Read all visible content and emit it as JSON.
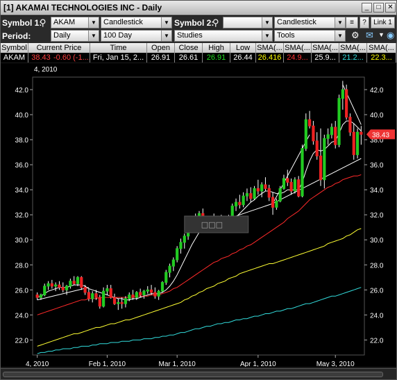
{
  "window": {
    "title": "[1] AKAMAI TECHNOLOGIES INC - Daily"
  },
  "toolbar": {
    "symbol1_label": "Symbol 1:",
    "symbol1_value": "AKAM",
    "chart_type_1": "Candlestick",
    "symbol2_label": "Symbol 2:",
    "symbol2_value": "",
    "chart_type_2": "Candlestick",
    "help_label": "?",
    "link_label": "Link 1",
    "period_label": "Period:",
    "period_value": "Daily",
    "range_value": "100 Day",
    "studies_value": "Studies",
    "tools_value": "Tools"
  },
  "quote": {
    "headers": [
      "Symbol",
      "Current Price",
      "Time",
      "Open",
      "Close",
      "High",
      "Low",
      "SMA(...",
      "SMA(...",
      "SMA(...",
      "SMA(...",
      "SMA(..."
    ],
    "row": [
      "AKAM",
      "38.43",
      "-0.60 (-1....",
      "Fri, Jan 15, 2...",
      "26.91",
      "26.61",
      "26.91",
      "26.44",
      "26.416",
      "24.9...",
      "25.9...",
      "21.2...",
      "22.3..."
    ],
    "colors": {
      "price": "#ff4040",
      "high": "#22dd22",
      "sma1": "#ffff00",
      "sma2": "#ff3030",
      "sma3": "#ffffff",
      "sma4": "#33dddd",
      "sma5": "#ffff00"
    }
  },
  "chart_data": {
    "type": "candlestick",
    "top_left_label": "4, 2010",
    "x_tick_labels": [
      "4, 2010",
      "Feb 1, 2010",
      "Mar 1, 2010",
      "Apr 1, 2010",
      "May 3, 2010"
    ],
    "x_tick_positions": [
      0,
      19,
      38,
      60,
      81
    ],
    "y_ticks": [
      "22.0",
      "24.0",
      "26.0",
      "28.0",
      "30.0",
      "32.0",
      "34.0",
      "36.0",
      "38.0",
      "40.0",
      "42.0"
    ],
    "ylim": [
      20.8,
      43.0
    ],
    "current_price_label": "38.43",
    "current_price": 38.43,
    "tooltip_text": "□□□",
    "colors": {
      "up": "#22cc22",
      "down": "#ee2222",
      "background": "#000000",
      "axis_text": "#ffffff",
      "price_box": "#ee3333"
    },
    "candles": [
      [
        25.6,
        25.8,
        25.2,
        25.4
      ],
      [
        25.4,
        25.7,
        25.2,
        25.6
      ],
      [
        25.6,
        26.5,
        25.5,
        26.3
      ],
      [
        26.3,
        26.7,
        26.0,
        26.5
      ],
      [
        26.5,
        26.8,
        26.1,
        26.3
      ],
      [
        26.3,
        26.6,
        25.9,
        26.4
      ],
      [
        26.4,
        26.7,
        26.0,
        26.2
      ],
      [
        26.2,
        26.6,
        25.8,
        26.0
      ],
      [
        26.0,
        26.4,
        25.6,
        26.3
      ],
      [
        26.3,
        26.9,
        26.1,
        26.7
      ],
      [
        26.7,
        27.1,
        26.4,
        26.5
      ],
      [
        26.5,
        27.1,
        26.3,
        27.0
      ],
      [
        27.0,
        27.1,
        26.0,
        26.2
      ],
      [
        26.2,
        26.4,
        25.6,
        25.8
      ],
      [
        25.8,
        26.1,
        25.1,
        25.3
      ],
      [
        25.3,
        25.9,
        25.0,
        25.7
      ],
      [
        25.7,
        26.0,
        25.2,
        25.4
      ],
      [
        25.4,
        25.6,
        24.5,
        24.7
      ],
      [
        24.7,
        26.2,
        24.6,
        25.9
      ],
      [
        25.9,
        26.4,
        25.6,
        26.1
      ],
      [
        26.1,
        26.4,
        25.3,
        25.4
      ],
      [
        25.4,
        25.7,
        24.8,
        24.9
      ],
      [
        24.9,
        25.3,
        24.4,
        25.0
      ],
      [
        25.0,
        25.4,
        24.5,
        24.9
      ],
      [
        24.9,
        25.5,
        24.6,
        25.3
      ],
      [
        25.3,
        25.8,
        25.1,
        25.6
      ],
      [
        25.6,
        26.0,
        25.2,
        25.4
      ],
      [
        25.4,
        25.9,
        25.2,
        25.8
      ],
      [
        25.8,
        26.1,
        25.4,
        25.6
      ],
      [
        25.6,
        26.0,
        25.3,
        25.9
      ],
      [
        25.9,
        26.3,
        25.7,
        26.0
      ],
      [
        26.0,
        26.4,
        25.6,
        25.8
      ],
      [
        25.8,
        26.2,
        25.3,
        25.5
      ],
      [
        25.5,
        26.0,
        25.2,
        25.9
      ],
      [
        25.9,
        26.7,
        25.8,
        26.6
      ],
      [
        26.6,
        27.6,
        26.4,
        27.4
      ],
      [
        27.4,
        28.1,
        27.0,
        27.9
      ],
      [
        27.9,
        28.6,
        27.5,
        28.4
      ],
      [
        28.4,
        29.5,
        28.2,
        29.3
      ],
      [
        29.3,
        30.1,
        28.9,
        29.8
      ],
      [
        29.8,
        30.5,
        29.3,
        30.3
      ],
      [
        30.3,
        31.3,
        30.0,
        31.1
      ],
      [
        31.1,
        31.8,
        30.6,
        31.5
      ],
      [
        31.5,
        32.1,
        30.9,
        31.7
      ],
      [
        31.7,
        32.3,
        31.2,
        32.1
      ],
      [
        32.1,
        32.5,
        31.3,
        31.5
      ],
      [
        31.5,
        31.9,
        30.8,
        31.3
      ],
      [
        31.3,
        31.8,
        30.9,
        31.6
      ],
      [
        31.6,
        32.1,
        31.0,
        31.4
      ],
      [
        31.4,
        31.9,
        31.1,
        31.7
      ],
      [
        31.7,
        32.0,
        31.2,
        31.5
      ],
      [
        31.5,
        31.8,
        30.9,
        31.2
      ],
      [
        31.2,
        32.0,
        31.1,
        31.9
      ],
      [
        31.9,
        32.9,
        31.7,
        32.7
      ],
      [
        32.7,
        33.3,
        32.3,
        33.0
      ],
      [
        33.0,
        33.6,
        32.5,
        32.8
      ],
      [
        32.8,
        33.8,
        32.6,
        33.5
      ],
      [
        33.5,
        34.1,
        33.1,
        33.7
      ],
      [
        33.7,
        34.2,
        33.0,
        33.3
      ],
      [
        33.3,
        34.3,
        33.2,
        34.1
      ],
      [
        34.1,
        34.8,
        33.6,
        33.9
      ],
      [
        33.9,
        34.6,
        33.4,
        34.4
      ],
      [
        34.4,
        35.0,
        33.9,
        34.1
      ],
      [
        34.1,
        34.4,
        33.1,
        33.4
      ],
      [
        33.4,
        33.8,
        32.0,
        32.6
      ],
      [
        32.6,
        33.3,
        32.4,
        33.1
      ],
      [
        33.1,
        34.3,
        33.0,
        34.1
      ],
      [
        34.1,
        35.2,
        34.0,
        34.9
      ],
      [
        34.9,
        35.6,
        34.3,
        34.6
      ],
      [
        34.6,
        34.9,
        33.6,
        33.9
      ],
      [
        33.9,
        35.0,
        33.7,
        34.8
      ],
      [
        34.8,
        35.1,
        33.4,
        33.5
      ],
      [
        33.5,
        37.6,
        33.4,
        37.3
      ],
      [
        37.3,
        40.1,
        37.1,
        39.6
      ],
      [
        39.6,
        40.3,
        38.9,
        39.1
      ],
      [
        39.1,
        39.5,
        37.6,
        37.9
      ],
      [
        37.9,
        38.6,
        36.4,
        36.7
      ],
      [
        36.7,
        38.9,
        34.3,
        34.8
      ],
      [
        34.8,
        38.4,
        34.1,
        38.1
      ],
      [
        38.1,
        38.9,
        37.6,
        38.4
      ],
      [
        38.4,
        39.3,
        38.1,
        39.0
      ],
      [
        39.0,
        39.5,
        37.3,
        37.6
      ],
      [
        37.6,
        41.6,
        37.4,
        41.3
      ],
      [
        41.3,
        42.7,
        40.4,
        42.0
      ],
      [
        42.0,
        42.4,
        39.6,
        39.8
      ],
      [
        39.8,
        40.1,
        38.3,
        38.6
      ],
      [
        38.6,
        39.3,
        36.4,
        36.8
      ],
      [
        36.8,
        38.9,
        36.5,
        38.6
      ],
      [
        38.6,
        39.1,
        37.6,
        38.43
      ]
    ],
    "series": [
      {
        "values": [
          25.4,
          25.5,
          25.7,
          25.9,
          26.0,
          26.1,
          26.2,
          26.2,
          26.2,
          26.3,
          26.4,
          26.4,
          26.4,
          26.3,
          26.1,
          26.0,
          25.9,
          25.8,
          25.7,
          25.6,
          25.5,
          25.4,
          25.3,
          25.3,
          25.2,
          25.2,
          25.3,
          25.3,
          25.4,
          25.5,
          25.6,
          25.7,
          25.7,
          25.7,
          25.8,
          26.0,
          26.3,
          26.7,
          27.2,
          27.8,
          28.4,
          29.0,
          29.6,
          30.1,
          30.6,
          31.0,
          31.3,
          31.5,
          31.6,
          31.6,
          31.6,
          31.5,
          31.5,
          31.6,
          31.8,
          32.1,
          32.4,
          32.7,
          33.0,
          33.2,
          33.5,
          33.7,
          33.9,
          33.9,
          33.8,
          33.7,
          33.7,
          33.8,
          34.0,
          34.0,
          34.0,
          34.0,
          34.6,
          35.5,
          36.3,
          36.9,
          37.2,
          37.1,
          37.2,
          37.5,
          37.8,
          37.9,
          38.5,
          39.2,
          39.5,
          39.5,
          39.3,
          39.0,
          38.7
        ]
      },
      {
        "values": [
          24.0,
          24.1,
          24.2,
          24.3,
          24.4,
          24.5,
          24.6,
          24.7,
          24.8,
          24.9,
          25.0,
          25.1,
          25.2,
          25.2,
          25.3,
          25.3,
          25.3,
          25.4,
          25.4,
          25.4,
          25.4,
          25.4,
          25.4,
          25.4,
          25.4,
          25.4,
          25.4,
          25.5,
          25.5,
          25.5,
          25.5,
          25.6,
          25.6,
          25.6,
          25.7,
          25.8,
          25.9,
          26.1,
          26.2,
          26.4,
          26.6,
          26.8,
          27.0,
          27.2,
          27.4,
          27.6,
          27.8,
          28.0,
          28.2,
          28.3,
          28.5,
          28.6,
          28.7,
          28.9,
          29.0,
          29.2,
          29.3,
          29.5,
          29.6,
          29.8,
          30.0,
          30.2,
          30.4,
          30.6,
          30.8,
          31.0,
          31.2,
          31.4,
          31.7,
          31.9,
          32.1,
          32.3,
          32.6,
          32.9,
          33.2,
          33.4,
          33.6,
          33.8,
          34.0,
          34.2,
          34.3,
          34.5,
          34.6,
          34.8,
          34.9,
          35.0,
          35.1,
          35.1,
          35.2
        ]
      },
      {
        "values": [
          21.5,
          21.6,
          21.7,
          21.8,
          21.9,
          22.0,
          22.1,
          22.2,
          22.3,
          22.4,
          22.5,
          22.5,
          22.6,
          22.7,
          22.8,
          22.9,
          23.0,
          23.0,
          23.1,
          23.2,
          23.3,
          23.3,
          23.4,
          23.5,
          23.6,
          23.6,
          23.7,
          23.8,
          23.9,
          24.0,
          24.1,
          24.2,
          24.3,
          24.4,
          24.5,
          24.6,
          24.7,
          24.8,
          24.9,
          25.0,
          25.2,
          25.3,
          25.5,
          25.6,
          25.8,
          25.9,
          26.1,
          26.2,
          26.3,
          26.5,
          26.6,
          26.7,
          26.9,
          27.0,
          27.1,
          27.3,
          27.4,
          27.5,
          27.6,
          27.7,
          27.8,
          27.9,
          28.0,
          28.1,
          28.1,
          28.2,
          28.3,
          28.4,
          28.5,
          28.6,
          28.7,
          28.8,
          28.9,
          29.0,
          29.1,
          29.2,
          29.3,
          29.4,
          29.5,
          29.7,
          29.8,
          29.9,
          30.0,
          30.1,
          30.3,
          30.4,
          30.6,
          30.8,
          30.9
        ]
      },
      {
        "values": [
          20.9,
          21.0,
          21.0,
          21.1,
          21.1,
          21.2,
          21.2,
          21.3,
          21.3,
          21.3,
          21.4,
          21.4,
          21.5,
          21.5,
          21.5,
          21.6,
          21.6,
          21.7,
          21.7,
          21.7,
          21.8,
          21.8,
          21.8,
          21.9,
          21.9,
          21.9,
          22.0,
          22.0,
          22.0,
          22.1,
          22.1,
          22.1,
          22.2,
          22.2,
          22.3,
          22.3,
          22.4,
          22.4,
          22.5,
          22.6,
          22.6,
          22.7,
          22.8,
          22.9,
          22.9,
          23.0,
          23.1,
          23.1,
          23.2,
          23.3,
          23.3,
          23.4,
          23.4,
          23.5,
          23.6,
          23.6,
          23.7,
          23.7,
          23.8,
          23.9,
          23.9,
          24.0,
          24.1,
          24.1,
          24.2,
          24.3,
          24.3,
          24.4,
          24.5,
          24.5,
          24.6,
          24.7,
          24.8,
          24.9,
          24.9,
          25.0,
          25.1,
          25.2,
          25.3,
          25.4,
          25.5,
          25.5,
          25.6,
          25.7,
          25.8,
          25.9,
          26.0,
          26.1,
          26.2
        ]
      }
    ],
    "series_colors": [
      "#ffffff",
      "#ff2a2a",
      "#ffff33",
      "#33dddd"
    ],
    "trendlines": [
      {
        "from": [
          0,
          25.2
        ],
        "to": [
          14,
          26.2
        ]
      },
      {
        "from": [
          43,
          30.8
        ],
        "to": [
          64,
          32.9
        ]
      },
      {
        "from": [
          64,
          32.9
        ],
        "to": [
          74,
          38.4
        ]
      },
      {
        "from": [
          64,
          32.9
        ],
        "to": [
          88,
          36.5
        ]
      },
      {
        "from": [
          83,
          42.4
        ],
        "to": [
          88,
          39.2
        ]
      }
    ]
  }
}
